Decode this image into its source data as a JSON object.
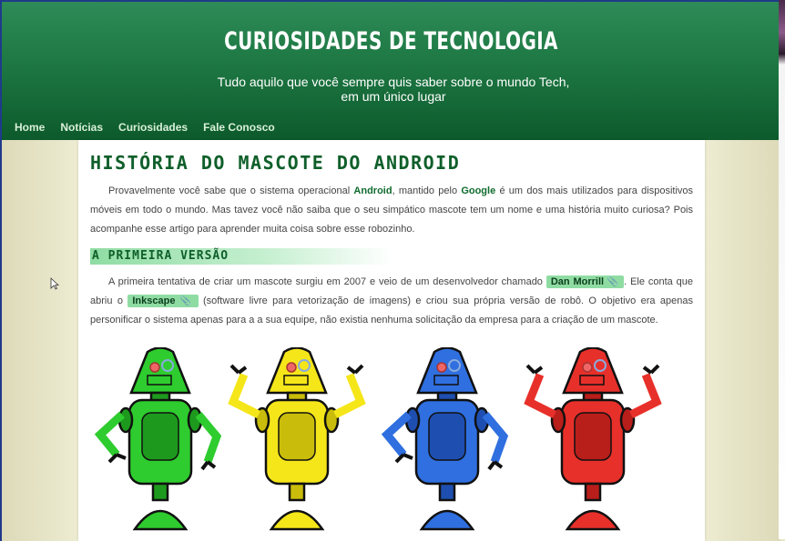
{
  "site": {
    "title": "CURIOSIDADES DE TECNOLOGIA",
    "tagline": "Tudo aquilo que você sempre quis saber sobre o mundo Tech, em um único lugar"
  },
  "nav": {
    "items": [
      "Home",
      "Notícias",
      "Curiosidades",
      "Fale Conosco"
    ]
  },
  "post": {
    "title": "HISTÓRIA DO MASCOTE DO ANDROID",
    "intro": {
      "p1": "Provavelmente você sabe que o sistema operacional ",
      "k1": "Android",
      "p2": ", mantido pelo ",
      "k2": "Google",
      "p3": " é um dos mais utilizados para dispositivos móveis em todo o mundo. Mas tavez você não saiba que o seu simpático mascote tem um nome e uma história muito curiosa? Pois acompanhe esse artigo para aprender muita coisa sobre esse robozinho."
    },
    "section_heading": "A PRIMEIRA VERSÃO",
    "section_para": {
      "p1": "A primeira tentativa de criar um mascote surgiu em 2007 e veio de um desenvolvedor chamado ",
      "tag1": "Dan Morrill",
      "p2": ". Ele conta que abriu o ",
      "tag2": "Inkscape",
      "p3": " (software livre para vetorização de imagens) e criou sua própria versão de robô. O objetivo era apenas personificar o sistema apenas para a a sua equipe, não existia nenhuma solicitação da empresa para a criação de um mascote."
    },
    "tag_icon": "pin-icon"
  },
  "robots": {
    "colors": [
      "#2ecc2e",
      "#f5e61a",
      "#2f6fe0",
      "#e8302a"
    ],
    "shade": [
      "#1d9a1d",
      "#c9bc0a",
      "#1e4fb0",
      "#b81e1a"
    ]
  }
}
